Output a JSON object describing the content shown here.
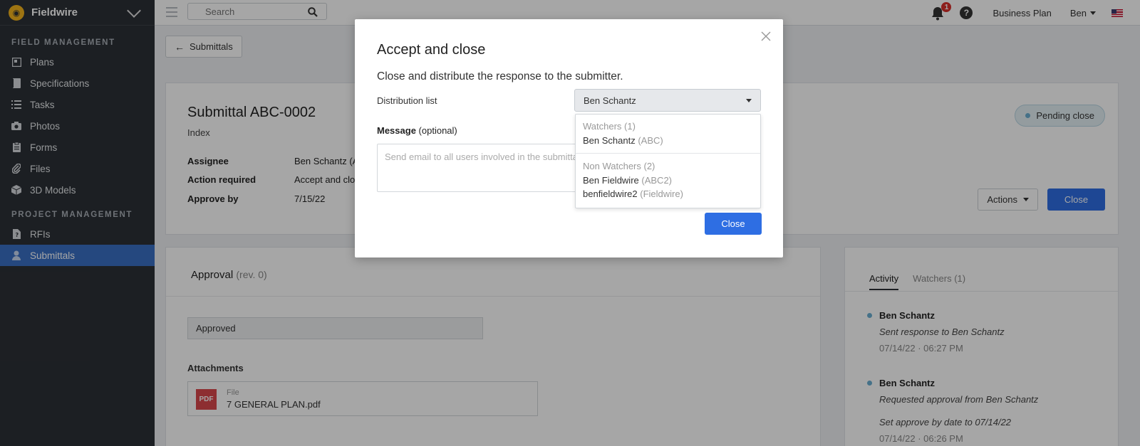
{
  "sidebar": {
    "brand": "Fieldwire",
    "sections": [
      {
        "title": "FIELD MANAGEMENT"
      },
      {
        "title": "PROJECT MANAGEMENT"
      }
    ],
    "items": [
      {
        "label": "Plans",
        "icon": "plans-icon"
      },
      {
        "label": "Specifications",
        "icon": "book-icon"
      },
      {
        "label": "Tasks",
        "icon": "list-icon"
      },
      {
        "label": "Photos",
        "icon": "camera-icon"
      },
      {
        "label": "Forms",
        "icon": "clipboard-icon"
      },
      {
        "label": "Files",
        "icon": "paperclip-icon"
      },
      {
        "label": "3D Models",
        "icon": "cube-icon"
      },
      {
        "label": "RFIs",
        "icon": "rfi-icon"
      },
      {
        "label": "Submittals",
        "icon": "person-icon"
      }
    ]
  },
  "topbar": {
    "search_placeholder": "Search",
    "notification_count": "1",
    "help": "?",
    "plan": "Business Plan",
    "user": "Ben"
  },
  "main": {
    "back_label": "Submittals",
    "title": "Submittal ABC-0002",
    "index": "Index",
    "fields": [
      {
        "label": "Assignee",
        "value": "Ben Schantz (A"
      },
      {
        "label": "Action required",
        "value": "Accept and clos"
      },
      {
        "label": "Approve by",
        "value": "7/15/22"
      }
    ],
    "status": "Pending close",
    "actions_label": "Actions",
    "close_label": "Close",
    "approval": {
      "title": "Approval",
      "rev": "(rev. 0)",
      "status_value": "Approved",
      "attachments_label": "Attachments",
      "file_kind": "File",
      "file_badge": "PDF",
      "file_name": "7 GENERAL PLAN.pdf"
    },
    "activity": {
      "tabs": [
        "Activity",
        "Watchers (1)"
      ],
      "entries": [
        {
          "who": "Ben Schantz",
          "what": "Sent response to Ben Schantz",
          "when": "07/14/22 · 06:27 PM"
        },
        {
          "who": "Ben Schantz",
          "what": "Requested approval from Ben Schantz",
          "what2": "Set approve by date to 07/14/22",
          "when": "07/14/22 · 06:26 PM"
        }
      ]
    }
  },
  "modal": {
    "title": "Accept and close",
    "subtitle": "Close and distribute the response to the submitter.",
    "distribution_label": "Distribution list",
    "distribution_value": "Ben Schantz",
    "message_label": "Message",
    "message_optional": "(optional)",
    "message_placeholder": "Send email to all users involved in the submittal",
    "close_button": "Close",
    "dropdown": {
      "groups": [
        {
          "label": "Watchers (1)",
          "options": [
            {
              "name": "Ben Schantz",
              "org": "(ABC)"
            }
          ]
        },
        {
          "label": "Non Watchers (2)",
          "options": [
            {
              "name": "Ben Fieldwire",
              "org": "(ABC2)"
            },
            {
              "name": "benfieldwire2",
              "org": "(Fieldwire)"
            }
          ]
        }
      ]
    }
  },
  "colors": {
    "sidebar_bg": "#2c3036",
    "active_nav": "#3a6fc4",
    "primary_button": "#2e6ee3",
    "status_dot": "#6aaed1"
  }
}
